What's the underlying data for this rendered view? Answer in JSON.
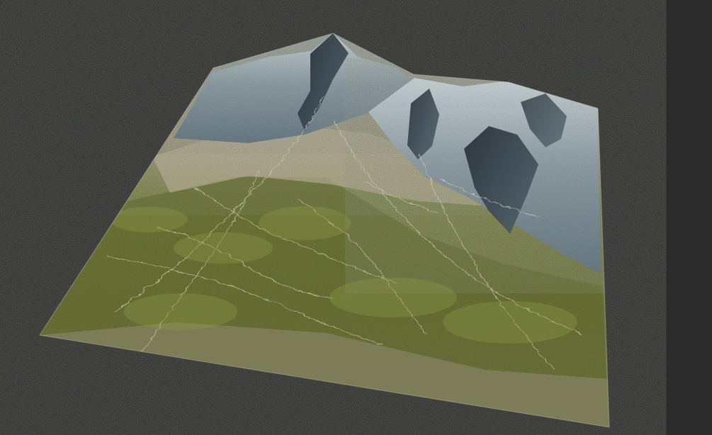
{
  "scene": {
    "subject": "terrain-render",
    "colors": {
      "background": "#2b2b2b",
      "grass_dark": "#5d6631",
      "grass_light": "#7d8a40",
      "soil": "#a9a28a",
      "dry_wash": "#c9c1a8",
      "rock_light": "#bcc7ca",
      "rock_mid": "#8f9fa7",
      "rock_dark": "#34414a",
      "ridge_shadow": "#1f2830"
    }
  }
}
